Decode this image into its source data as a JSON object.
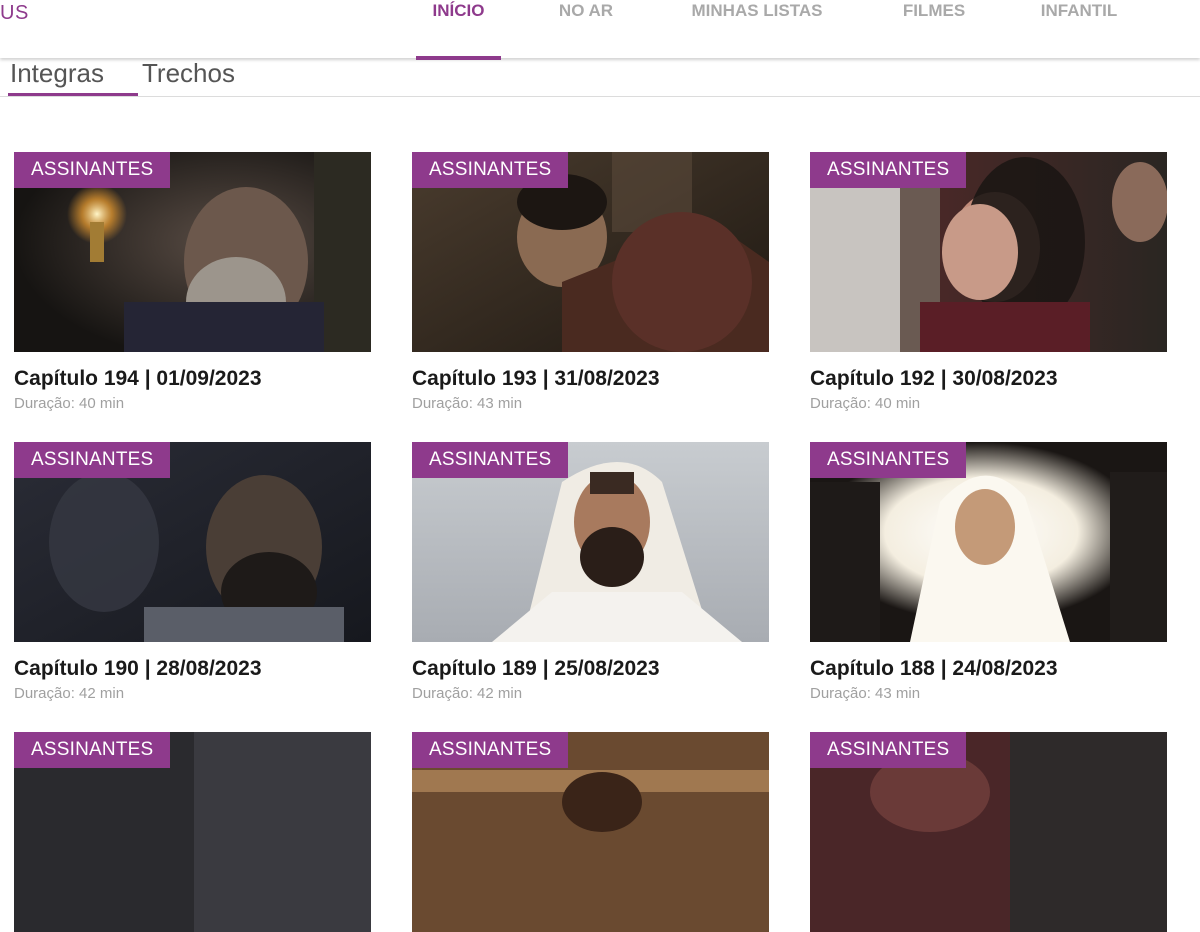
{
  "header": {
    "logo_fragment": "US",
    "nav": [
      {
        "label": "INÍCIO",
        "active": true
      },
      {
        "label": "NO AR",
        "active": false
      },
      {
        "label": "MINHAS LISTAS",
        "active": false
      },
      {
        "label": "FILMES",
        "active": false
      },
      {
        "label": "INFANTIL",
        "active": false
      }
    ],
    "accent_color": "#8e3a8c"
  },
  "subtabs": [
    {
      "label": "Integras",
      "active": true
    },
    {
      "label": "Trechos",
      "active": false
    }
  ],
  "cards": [
    {
      "badge": "ASSINANTES",
      "title": "Capítulo 194 | 01/09/2023",
      "duration": "Duração: 40 min"
    },
    {
      "badge": "ASSINANTES",
      "title": "Capítulo 193 | 31/08/2023",
      "duration": "Duração: 43 min"
    },
    {
      "badge": "ASSINANTES",
      "title": "Capítulo 192 | 30/08/2023",
      "duration": "Duração: 40 min"
    },
    {
      "badge": "ASSINANTES",
      "title": "Capítulo 190 | 28/08/2023",
      "duration": "Duração: 42 min"
    },
    {
      "badge": "ASSINANTES",
      "title": "Capítulo 189 | 25/08/2023",
      "duration": "Duração: 42 min"
    },
    {
      "badge": "ASSINANTES",
      "title": "Capítulo 188 | 24/08/2023",
      "duration": "Duração: 43 min"
    },
    {
      "badge": "ASSINANTES",
      "title": "",
      "duration": ""
    },
    {
      "badge": "ASSINANTES",
      "title": "",
      "duration": ""
    },
    {
      "badge": "ASSINANTES",
      "title": "",
      "duration": ""
    }
  ]
}
